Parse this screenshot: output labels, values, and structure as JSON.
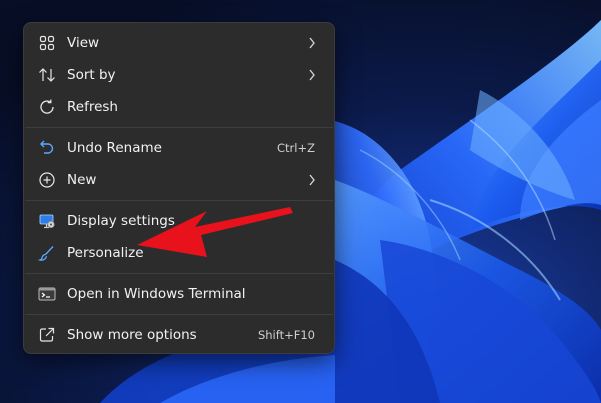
{
  "menu": {
    "group1": [
      {
        "label": "View",
        "icon": "grid-icon",
        "submenu": true
      },
      {
        "label": "Sort by",
        "icon": "sort-icon",
        "submenu": true
      },
      {
        "label": "Refresh",
        "icon": "refresh-icon",
        "submenu": false
      }
    ],
    "group2": [
      {
        "label": "Undo Rename",
        "icon": "undo-icon",
        "shortcut": "Ctrl+Z"
      },
      {
        "label": "New",
        "icon": "new-icon",
        "submenu": true
      }
    ],
    "group3": [
      {
        "label": "Display settings",
        "icon": "display-settings-icon"
      },
      {
        "label": "Personalize",
        "icon": "brush-icon"
      }
    ],
    "group4": [
      {
        "label": "Open in Windows Terminal",
        "icon": "terminal-icon"
      }
    ],
    "group5": [
      {
        "label": "Show more options",
        "icon": "share-icon",
        "shortcut": "Shift+F10"
      }
    ]
  },
  "colors": {
    "menu_bg": "#2c2c2c",
    "text": "#f2f2f2",
    "accent_arrow": "#e8121d",
    "wallpaper_blue": "#1e5bff"
  }
}
